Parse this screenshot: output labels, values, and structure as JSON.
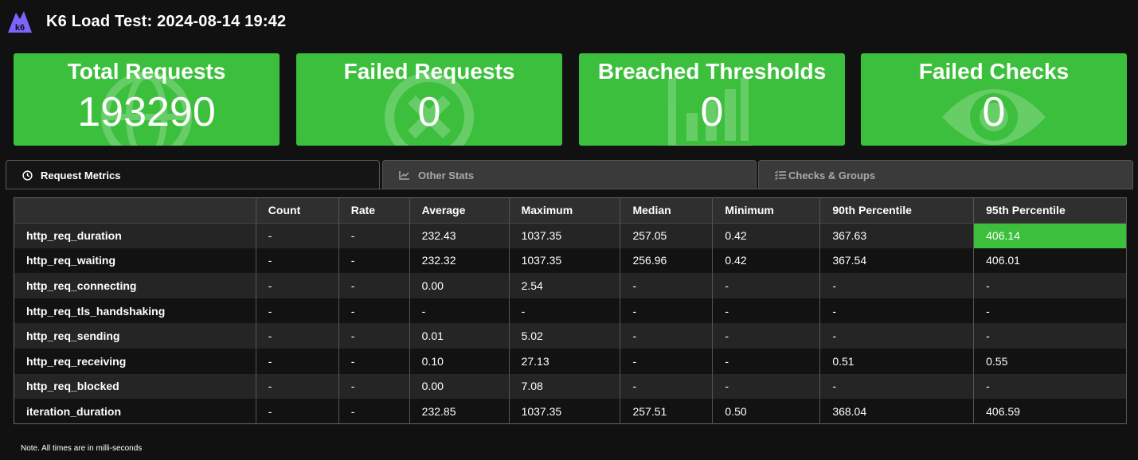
{
  "header": {
    "title": "K6 Load Test: 2024-08-14 19:42",
    "logo_text": "k6"
  },
  "colors": {
    "accent_green": "#3cbf3c",
    "logo_purple": "#7d64ff",
    "background": "#111111"
  },
  "cards": [
    {
      "title": "Total Requests",
      "value": "193290",
      "icon": "globe-icon"
    },
    {
      "title": "Failed Requests",
      "value": "0",
      "icon": "x-circle-icon"
    },
    {
      "title": "Breached Thresholds",
      "value": "0",
      "icon": "bar-chart-icon"
    },
    {
      "title": "Failed Checks",
      "value": "0",
      "icon": "eye-icon"
    }
  ],
  "tabs": [
    {
      "label": "Request Metrics",
      "icon": "clock-icon",
      "active": true
    },
    {
      "label": "Other Stats",
      "icon": "line-chart-icon",
      "active": false
    },
    {
      "label": "Checks & Groups",
      "icon": "checklist-icon",
      "active": false
    }
  ],
  "table": {
    "headers": [
      "",
      "Count",
      "Rate",
      "Average",
      "Maximum",
      "Median",
      "Minimum",
      "90th Percentile",
      "95th Percentile"
    ],
    "rows": [
      [
        "http_req_duration",
        "-",
        "-",
        "232.43",
        "1037.35",
        "257.05",
        "0.42",
        "367.63",
        "406.14"
      ],
      [
        "http_req_waiting",
        "-",
        "-",
        "232.32",
        "1037.35",
        "256.96",
        "0.42",
        "367.54",
        "406.01"
      ],
      [
        "http_req_connecting",
        "-",
        "-",
        "0.00",
        "2.54",
        "-",
        "-",
        "-",
        "-"
      ],
      [
        "http_req_tls_handshaking",
        "-",
        "-",
        "-",
        "-",
        "-",
        "-",
        "-",
        "-"
      ],
      [
        "http_req_sending",
        "-",
        "-",
        "0.01",
        "5.02",
        "-",
        "-",
        "-",
        "-"
      ],
      [
        "http_req_receiving",
        "-",
        "-",
        "0.10",
        "27.13",
        "-",
        "-",
        "0.51",
        "0.55"
      ],
      [
        "http_req_blocked",
        "-",
        "-",
        "0.00",
        "7.08",
        "-",
        "-",
        "-",
        "-"
      ],
      [
        "iteration_duration",
        "-",
        "-",
        "232.85",
        "1037.35",
        "257.51",
        "0.50",
        "368.04",
        "406.59"
      ]
    ]
  },
  "note": "Note. All times are in milli-seconds"
}
